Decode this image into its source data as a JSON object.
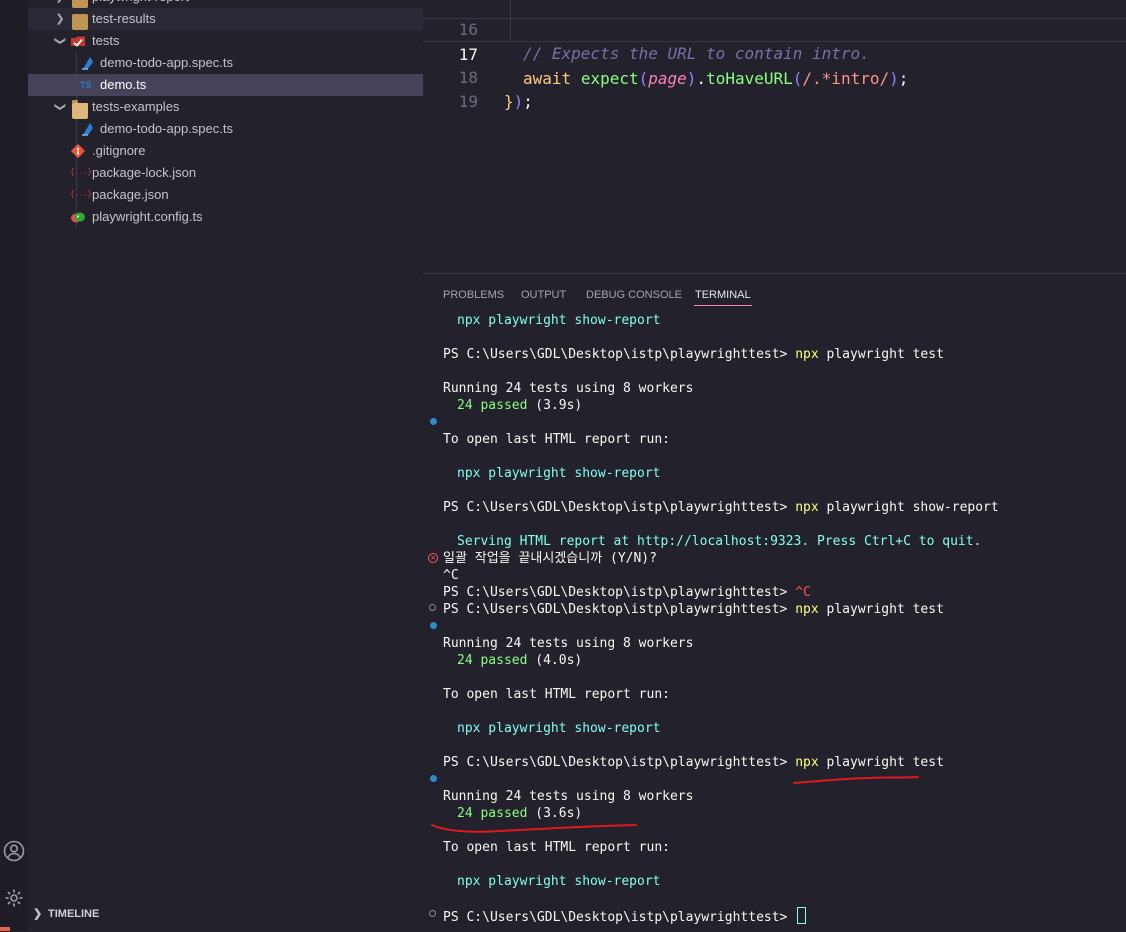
{
  "explorer": {
    "items": [
      {
        "label": "playwright-report"
      },
      {
        "label": "test-results"
      },
      {
        "label": "tests"
      },
      {
        "label": "demo-todo-app.spec.ts"
      },
      {
        "label": "demo.ts"
      },
      {
        "label": "tests-examples"
      },
      {
        "label": "demo-todo-app.spec.ts"
      },
      {
        "label": ".gitignore"
      },
      {
        "label": "package-lock.json"
      },
      {
        "label": "package.json"
      },
      {
        "label": "playwright.config.ts"
      }
    ],
    "ts_badge": "TS",
    "json_badge": "{...}",
    "timeline_label": "TIMELINE"
  },
  "editor": {
    "lines": [
      {
        "number": "16",
        "comment": "// Expects the URL to contain intro."
      },
      {
        "number": "17",
        "await": "await",
        "expect": "expect",
        "paren_open": "(",
        "page": "page",
        "paren_close": ")",
        "dot": ".",
        "method": "toHaveURL",
        "call_open": "(",
        "regex": "/.*intro/",
        "call_close": ")",
        "semi": ";"
      },
      {
        "number": "18",
        "brace": "}",
        "close_paren": ")",
        "semi": ";"
      },
      {
        "number": "19"
      }
    ]
  },
  "panel": {
    "tabs": [
      {
        "label": "PROBLEMS"
      },
      {
        "label": "OUTPUT"
      },
      {
        "label": "DEBUG CONSOLE"
      },
      {
        "label": "TERMINAL"
      }
    ],
    "active_tab": "TERMINAL"
  },
  "terminal": {
    "prompt": "PS C:\\Users\\GDL\\Desktop\\istp\\playwrighttest> ",
    "npx": "npx",
    "cmd_test": " playwright test",
    "cmd_show_report": " playwright show-report",
    "show_report_hint": "npx playwright show-report",
    "running": "Running 24 tests using 8 workers",
    "passed_1": "24 passed",
    "time_1": " (3.9s)",
    "passed_2": "24 passed",
    "time_2": " (4.0s)",
    "passed_3": "24 passed",
    "time_3": " (3.6s)",
    "open_report": "To open last HTML report run:",
    "serving": "Serving HTML report at http://localhost:9323. Press Ctrl+C to quit.",
    "terminate_prompt": "일괄 작업을 끝내시겠습니까 (Y/N)?",
    "ctrl_c": "^C",
    "annotation_color": "#e0191f"
  },
  "colors": {
    "background": "#22212c",
    "accent_tab": "#ff80bf",
    "cyan": "#80ffea",
    "green": "#8aff80",
    "yellow": "#ffff80",
    "red": "#ff5555"
  }
}
